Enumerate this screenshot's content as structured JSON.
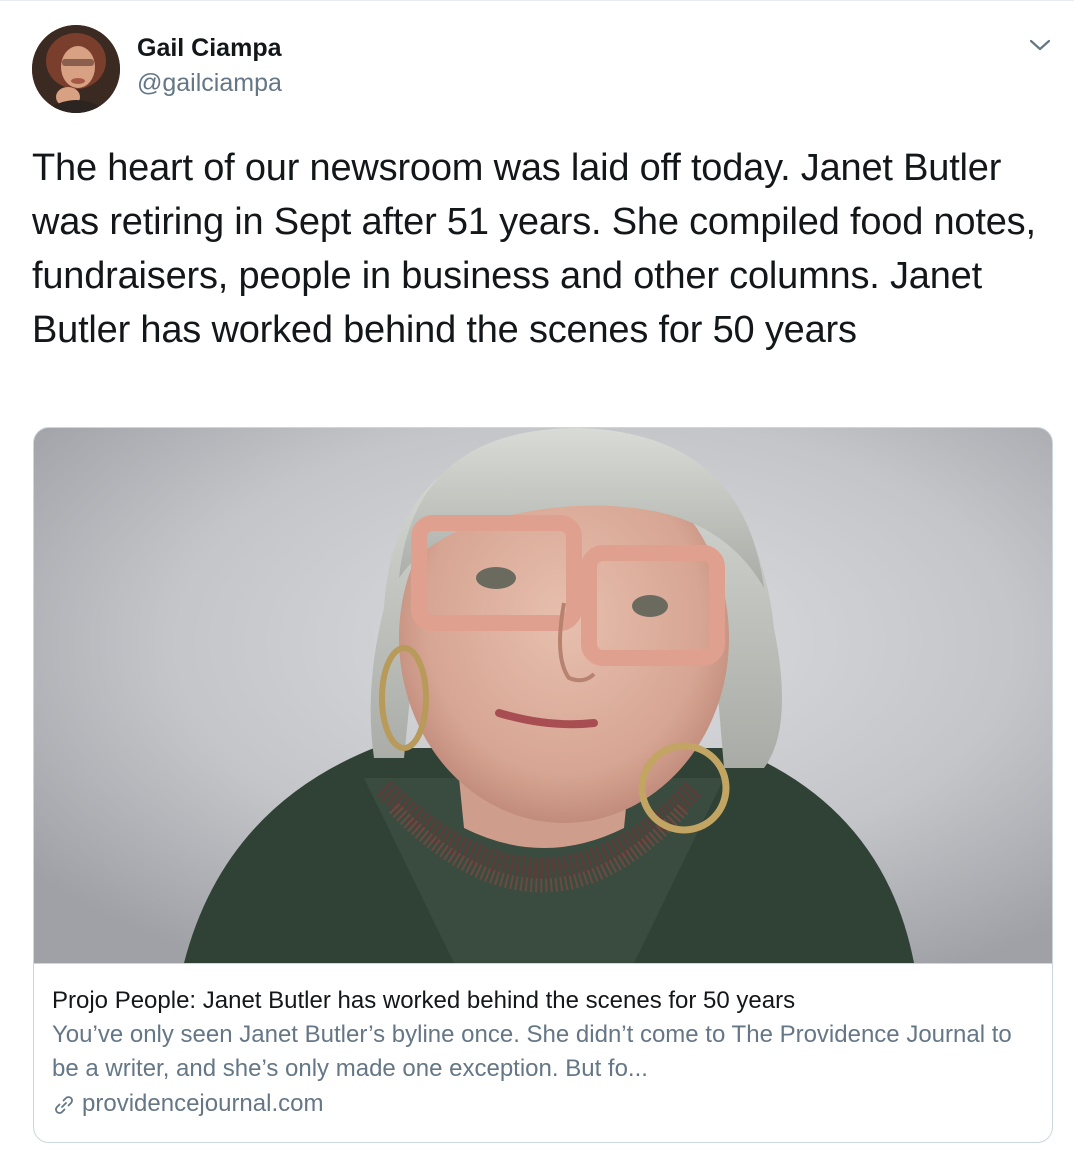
{
  "tweet": {
    "author": {
      "name": "Gail Ciampa",
      "handle": "@gailciampa"
    },
    "text": "The heart of our newsroom was laid off today. Janet Butler was retiring in Sept after 51 years. She compiled food notes, fundraisers, people in business and other columns. Janet Butler has worked behind the scenes for 50 years",
    "menu_icon": "chevron-down-icon",
    "card": {
      "title": "Projo People: Janet Butler has worked behind the scenes for 50 years",
      "description": "You’ve only seen Janet Butler’s byline once. She didn’t come to The Providence Journal to be a writer, and she’s only made one exception. But fo...",
      "domain": "providencejournal.com",
      "link_icon": "link-icon"
    }
  },
  "colors": {
    "primary_text": "#14171a",
    "secondary_text": "#657786",
    "border": "#ccd6dd"
  }
}
